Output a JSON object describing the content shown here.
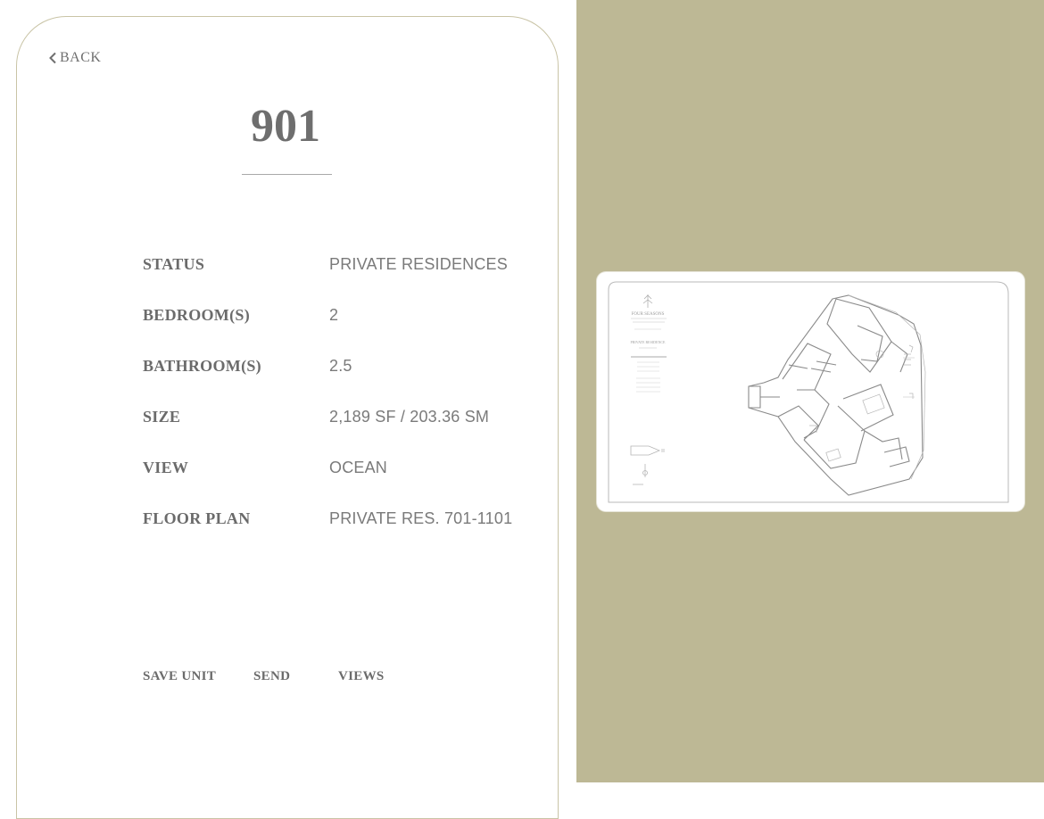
{
  "nav": {
    "back_label": "BACK"
  },
  "unit": {
    "number": "901"
  },
  "details": [
    {
      "label": "STATUS",
      "value": "PRIVATE RESIDENCES"
    },
    {
      "label": "BEDROOM(S)",
      "value": "2"
    },
    {
      "label": "BATHROOM(S)",
      "value": "2.5"
    },
    {
      "label": "SIZE",
      "value": "2,189 SF / 203.36 SM"
    },
    {
      "label": "VIEW",
      "value": "OCEAN"
    },
    {
      "label": "FLOOR PLAN",
      "value": "PRIVATE RES. 701-1101"
    }
  ],
  "actions": {
    "save_label": "SAVE UNIT",
    "send_label": "SEND",
    "views_label": "VIEWS"
  },
  "floor_plan": {
    "brand": "FOUR SEASONS",
    "residence_label": "PRIVATE RESIDENCE"
  },
  "colors": {
    "accent_panel": "#bdb895",
    "card_border": "#c9c4a6",
    "text_gray": "#6b6b6b"
  },
  "icons": {
    "back": "chevron-left-icon"
  }
}
